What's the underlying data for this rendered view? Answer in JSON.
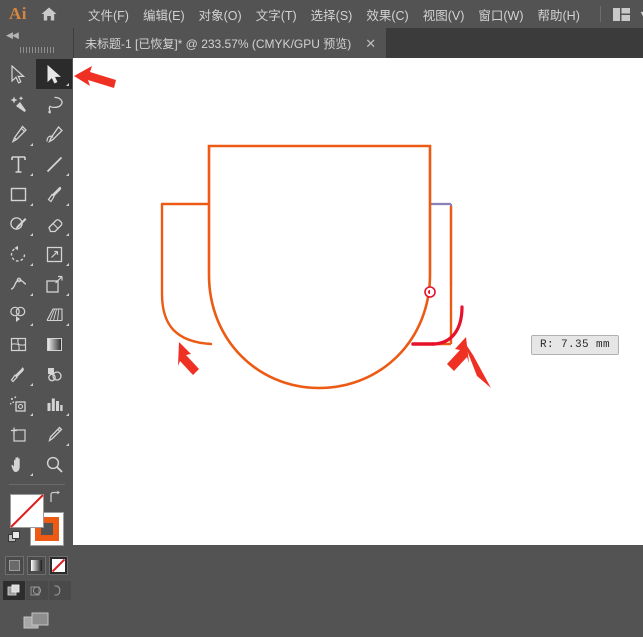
{
  "app": {
    "logo": "Ai",
    "home_icon": "home-icon",
    "workspace_icon": "workspace-switcher-icon",
    "workspace_chevron": "▼"
  },
  "menubar": {
    "items": [
      {
        "label": "文件(F)",
        "name": "menu-file"
      },
      {
        "label": "编辑(E)",
        "name": "menu-edit"
      },
      {
        "label": "对象(O)",
        "name": "menu-object"
      },
      {
        "label": "文字(T)",
        "name": "menu-type"
      },
      {
        "label": "选择(S)",
        "name": "menu-select"
      },
      {
        "label": "效果(C)",
        "name": "menu-effect"
      },
      {
        "label": "视图(V)",
        "name": "menu-view"
      },
      {
        "label": "窗口(W)",
        "name": "menu-window"
      },
      {
        "label": "帮助(H)",
        "name": "menu-help"
      }
    ]
  },
  "tabbar": {
    "document_title": "未标题-1 [已恢复]* @ 233.57% (CMYK/GPU 预览)",
    "close_label": "✕"
  },
  "toolbar": {
    "collapse_label": "◀◀",
    "tools": [
      {
        "name": "selection-tool",
        "label": "选择工具",
        "active": false,
        "flyout": false
      },
      {
        "name": "direct-selection-tool",
        "label": "直接选择工具",
        "active": true,
        "flyout": true
      },
      {
        "name": "magic-wand-tool",
        "label": "魔棒工具",
        "active": false,
        "flyout": false
      },
      {
        "name": "lasso-tool",
        "label": "套索工具",
        "active": false,
        "flyout": false
      },
      {
        "name": "pen-tool",
        "label": "钢笔工具",
        "active": false,
        "flyout": true
      },
      {
        "name": "curvature-tool",
        "label": "曲率工具",
        "active": false,
        "flyout": false
      },
      {
        "name": "type-tool",
        "label": "文字工具",
        "active": false,
        "flyout": true
      },
      {
        "name": "line-segment-tool",
        "label": "直线段工具",
        "active": false,
        "flyout": true
      },
      {
        "name": "rectangle-tool",
        "label": "矩形工具",
        "active": false,
        "flyout": true
      },
      {
        "name": "paintbrush-tool",
        "label": "画笔工具",
        "active": false,
        "flyout": true
      },
      {
        "name": "shaper-tool",
        "label": "Shaper 工具",
        "active": false,
        "flyout": true
      },
      {
        "name": "eraser-tool",
        "label": "橡皮擦工具",
        "active": false,
        "flyout": true
      },
      {
        "name": "rotate-tool",
        "label": "旋转工具",
        "active": false,
        "flyout": true
      },
      {
        "name": "scale-tool",
        "label": "比例缩放工具",
        "active": false,
        "flyout": true
      },
      {
        "name": "width-tool",
        "label": "宽度工具",
        "active": false,
        "flyout": true
      },
      {
        "name": "free-transform-tool",
        "label": "自由变换工具",
        "active": false,
        "flyout": true
      },
      {
        "name": "shape-builder-tool",
        "label": "形状生成器工具",
        "active": false,
        "flyout": true
      },
      {
        "name": "perspective-grid-tool",
        "label": "透视网格工具",
        "active": false,
        "flyout": true
      },
      {
        "name": "mesh-tool",
        "label": "网格工具",
        "active": false,
        "flyout": false
      },
      {
        "name": "gradient-tool",
        "label": "渐变工具",
        "active": false,
        "flyout": false
      },
      {
        "name": "eyedropper-tool",
        "label": "吸管工具",
        "active": false,
        "flyout": true
      },
      {
        "name": "blend-tool",
        "label": "混合工具",
        "active": false,
        "flyout": false
      },
      {
        "name": "symbol-sprayer-tool",
        "label": "符号喷枪工具",
        "active": false,
        "flyout": true
      },
      {
        "name": "column-graph-tool",
        "label": "柱形图工具",
        "active": false,
        "flyout": true
      },
      {
        "name": "artboard-tool",
        "label": "画板工具",
        "active": false,
        "flyout": false
      },
      {
        "name": "slice-tool",
        "label": "切片工具",
        "active": false,
        "flyout": true
      },
      {
        "name": "hand-tool",
        "label": "抓手工具",
        "active": false,
        "flyout": true
      },
      {
        "name": "zoom-tool",
        "label": "缩放工具",
        "active": false,
        "flyout": false
      }
    ],
    "fill_color": "#ffffff",
    "fill_is_none": true,
    "stroke_color": "#ec5a14",
    "swap_icon": "swap-fill-stroke-icon",
    "default_icon": "default-fill-stroke-icon",
    "paint_modes": [
      {
        "name": "color-mode-button",
        "label": "颜色",
        "selected": false
      },
      {
        "name": "gradient-mode-button",
        "label": "渐变",
        "selected": false
      },
      {
        "name": "none-mode-button",
        "label": "无",
        "selected": true
      }
    ],
    "draw_modes": [
      {
        "name": "draw-normal-button",
        "label": "正常绘图",
        "selected": true
      },
      {
        "name": "draw-behind-button",
        "label": "背面绘图",
        "selected": false
      },
      {
        "name": "draw-inside-button",
        "label": "内部绘图",
        "selected": false
      }
    ],
    "screen_mode_icon": "screen-mode-icon"
  },
  "canvas": {
    "tooltip": "R: 7.35 mm",
    "stroke_color": "#ec5a14",
    "selection_color": "#8a7fb8",
    "radius_preview_color": "#e8102a",
    "corner_widget": "corner-radius-widget",
    "annotations": [
      {
        "name": "annotation-arrow-tool",
        "color": "#ef3124"
      },
      {
        "name": "annotation-arrow-left-corner",
        "color": "#ef3124"
      },
      {
        "name": "annotation-arrow-right-corner",
        "color": "#ef3124"
      }
    ]
  }
}
